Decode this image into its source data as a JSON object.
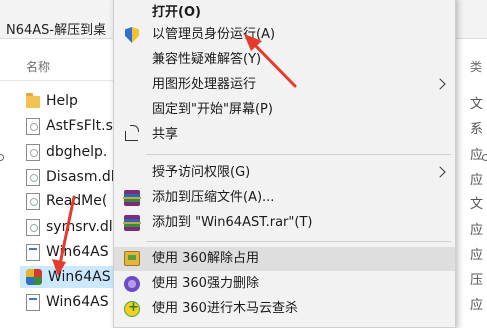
{
  "window": {
    "title": "N64AS-解压到桌"
  },
  "file_list": {
    "column_name": "名称",
    "items": [
      {
        "name": "Help",
        "type": "folder"
      },
      {
        "name": "AstFsFlt.s",
        "type": "doc"
      },
      {
        "name": "dbghelp.",
        "type": "doc"
      },
      {
        "name": "Disasm.dl",
        "type": "doc"
      },
      {
        "name": "ReadMe(",
        "type": "doc"
      },
      {
        "name": "symsrv.dl",
        "type": "doc"
      },
      {
        "name": "Win64AS",
        "type": "exe"
      },
      {
        "name": "Win64AS",
        "type": "app"
      },
      {
        "name": "Win64AS",
        "type": "exe"
      }
    ]
  },
  "right_column": {
    "header": "类",
    "cells": [
      "文",
      "系",
      "应",
      "应",
      "文",
      "应",
      "应",
      "压",
      "应"
    ]
  },
  "context_menu": {
    "open": "打开(O)",
    "run_as_admin": "以管理员身份运行(A)",
    "troubleshoot": "兼容性疑难解答(Y)",
    "run_with_gpu": "用图形处理器运行",
    "pin_start": "固定到\"开始\"屏幕(P)",
    "share": "共享",
    "grant_access": "授予访问权限(G)",
    "add_archive": "添加到压缩文件(A)...",
    "add_rar": "添加到 \"Win64AST.rar\"(T)",
    "unlock_360": "使用 360解除占用",
    "delete_360": "使用 360强力删除",
    "scan_360": "使用 360进行木马云查杀"
  },
  "colors": {
    "annotation_arrow": "#e53b2c",
    "menu_bg": "#f2f2f2",
    "selection": "#cce8ff"
  }
}
